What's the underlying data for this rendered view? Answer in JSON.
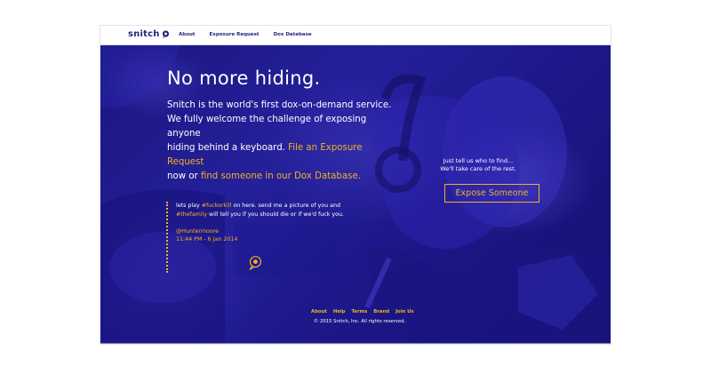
{
  "brand": {
    "name": "snitch",
    "accent": "#f5b21c",
    "primary": "#27237a"
  },
  "nav": {
    "items": [
      {
        "label": "About"
      },
      {
        "label": "Exposure Request"
      },
      {
        "label": "Dox Database"
      }
    ]
  },
  "hero": {
    "headline": "No more hiding.",
    "intro": {
      "line1": "Snitch is the world's first dox-on-demand service.",
      "line2": "We fully welcome the challenge of exposing anyone",
      "line3a": "hiding behind a keyboard. ",
      "link1": "File an Exposure Request",
      "line4a": "now or ",
      "link2": "find someone in our Dox Database."
    },
    "cta": {
      "line1": "Just tell us who to find...",
      "line2": "We'll take care of the rest.",
      "button_label": "Expose Someone"
    }
  },
  "tweet": {
    "text_a": "lets play ",
    "tag1": "#fuckorkill",
    "text_b": " on here. send me a picture of you and ",
    "tag2": "#thefamily",
    "text_c": " will tell you if you should die or if we'd fuck you.",
    "user": "@Huntermoore",
    "time": "11:44 PM - 6 Jan 2014"
  },
  "footer": {
    "links": [
      {
        "label": "About"
      },
      {
        "label": "Help"
      },
      {
        "label": "Terms"
      },
      {
        "label": "Brand"
      },
      {
        "label": "Join Us"
      }
    ],
    "copyright": "© 2015 Snitch, Inc. All rights reserved."
  }
}
